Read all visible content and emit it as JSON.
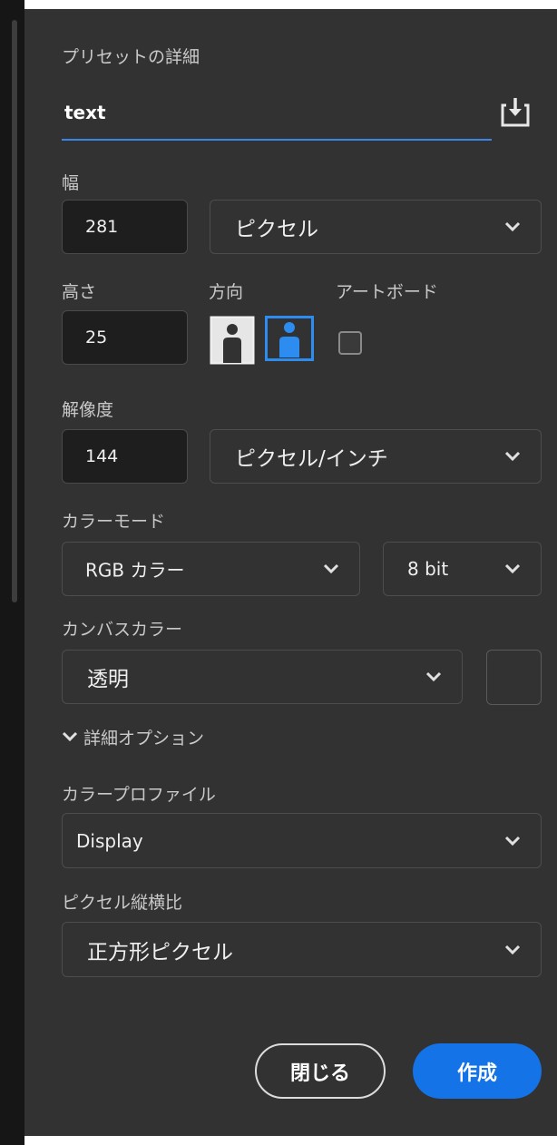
{
  "preset": {
    "heading": "プリセットの詳細",
    "name_value": "text"
  },
  "width": {
    "label": "幅",
    "value": "281",
    "unit": "ピクセル"
  },
  "height": {
    "label": "高さ",
    "value": "25"
  },
  "orientation": {
    "label": "方向",
    "selected": "landscape"
  },
  "artboard": {
    "label": "アートボード",
    "checked": false
  },
  "resolution": {
    "label": "解像度",
    "value": "144",
    "unit": "ピクセル/インチ"
  },
  "color_mode": {
    "label": "カラーモード",
    "mode": "RGB カラー",
    "depth": "8 bit"
  },
  "canvas_color": {
    "label": "カンバスカラー",
    "value": "透明"
  },
  "advanced": {
    "label": "詳細オプション"
  },
  "color_profile": {
    "label": "カラープロファイル",
    "value": "Display"
  },
  "pixel_aspect": {
    "label": "ピクセル縦横比",
    "value": "正方形ピクセル"
  },
  "buttons": {
    "close": "閉じる",
    "create": "作成"
  },
  "colors": {
    "accent": "#1473e6",
    "panel": "#323232",
    "field": "#1e1e1e"
  },
  "icons": [
    "save-preset-icon",
    "portrait-icon",
    "landscape-icon",
    "chevron-down-icon"
  ]
}
